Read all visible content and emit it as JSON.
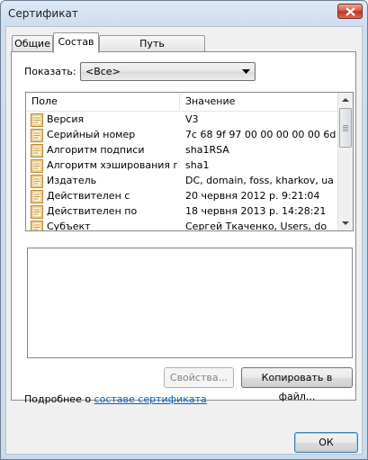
{
  "window": {
    "title": "Сертификат"
  },
  "tabs": [
    {
      "label": "Общие"
    },
    {
      "label": "Состав"
    },
    {
      "label": "Путь сертификации"
    }
  ],
  "show": {
    "label": "Показать:",
    "selected": "<Все>"
  },
  "columns": {
    "field": "Поле",
    "value": "Значение"
  },
  "rows": [
    {
      "field": "Версия",
      "value": "V3"
    },
    {
      "field": "Серийный номер",
      "value": "7c 68 9f 97 00 00 00 00 00 6d"
    },
    {
      "field": "Алгоритм подписи",
      "value": "sha1RSA"
    },
    {
      "field": "Алгоритм хэширования по...",
      "value": "sha1"
    },
    {
      "field": "Издатель",
      "value": "DC, domain, foss, kharkov, ua"
    },
    {
      "field": "Действителен с",
      "value": "20 червня 2012 р. 9:21:04"
    },
    {
      "field": "Действителен по",
      "value": "18 червня 2013 р. 14:28:21"
    },
    {
      "field": "Субъект",
      "value": "Сергей Ткаченко, Users, do"
    }
  ],
  "buttons": {
    "properties": "Свойства...",
    "copy": "Копировать в файл...",
    "ok": "ОК"
  },
  "more": {
    "prefix": "Подробнее о ",
    "link": "составе сертификата"
  }
}
